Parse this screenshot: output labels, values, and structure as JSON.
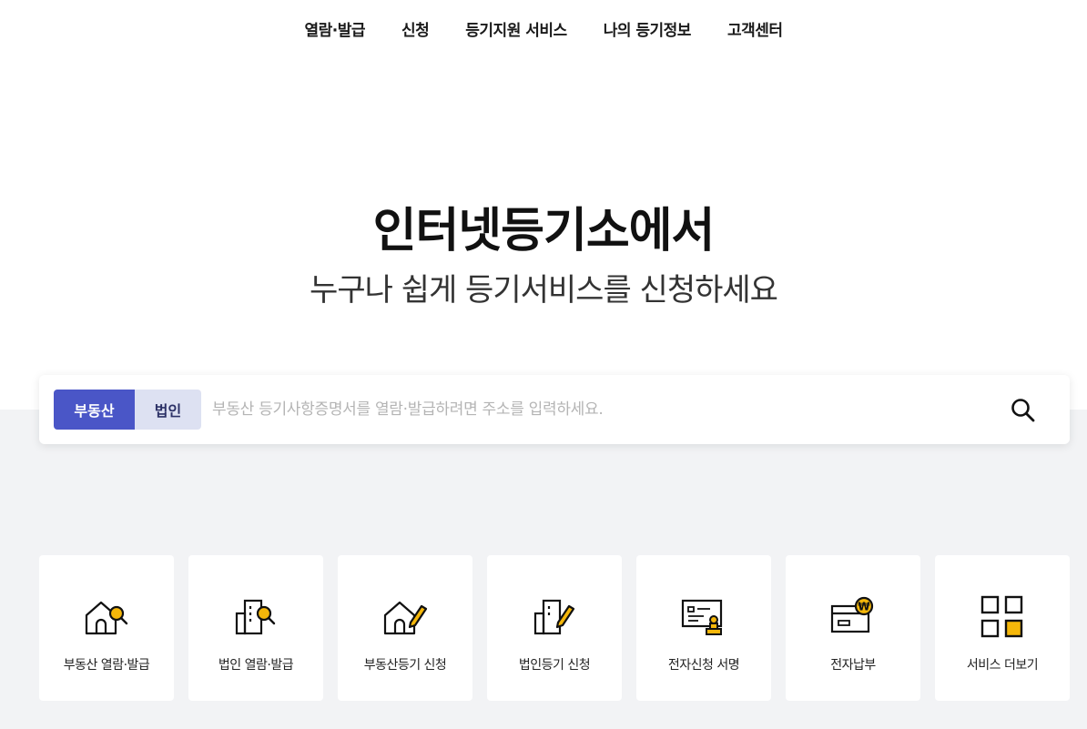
{
  "nav": {
    "items": [
      {
        "label": "열람·발급"
      },
      {
        "label": "신청"
      },
      {
        "label": "등기지원 서비스"
      },
      {
        "label": "나의 등기정보"
      },
      {
        "label": "고객센터"
      }
    ]
  },
  "hero": {
    "title": "인터넷등기소에서",
    "subtitle": "누구나 쉽게 등기서비스를 신청하세요"
  },
  "search": {
    "tabs": [
      {
        "label": "부동산",
        "selected": true
      },
      {
        "label": "법인",
        "selected": false
      }
    ],
    "placeholder": "부동산 등기사항증명서를 열람·발급하려면 주소를 입력하세요.",
    "value": "",
    "icon": "search-icon"
  },
  "quick_menu": {
    "items": [
      {
        "label": "부동산 열람·발급",
        "icon": "house-search-icon"
      },
      {
        "label": "법인 열람·발급",
        "icon": "building-search-icon"
      },
      {
        "label": "부동산등기 신청",
        "icon": "house-pen-icon"
      },
      {
        "label": "법인등기 신청",
        "icon": "building-pen-icon"
      },
      {
        "label": "전자신청 서명",
        "icon": "certificate-stamp-icon"
      },
      {
        "label": "전자납부",
        "icon": "card-won-icon"
      },
      {
        "label": "서비스 더보기",
        "icon": "grid-more-icon"
      }
    ]
  },
  "colors": {
    "accent": "#4a56c7",
    "accent_light": "#dde1f2",
    "icon_yellow": "#f5b70a",
    "gray_bg": "#f2f3f5"
  }
}
